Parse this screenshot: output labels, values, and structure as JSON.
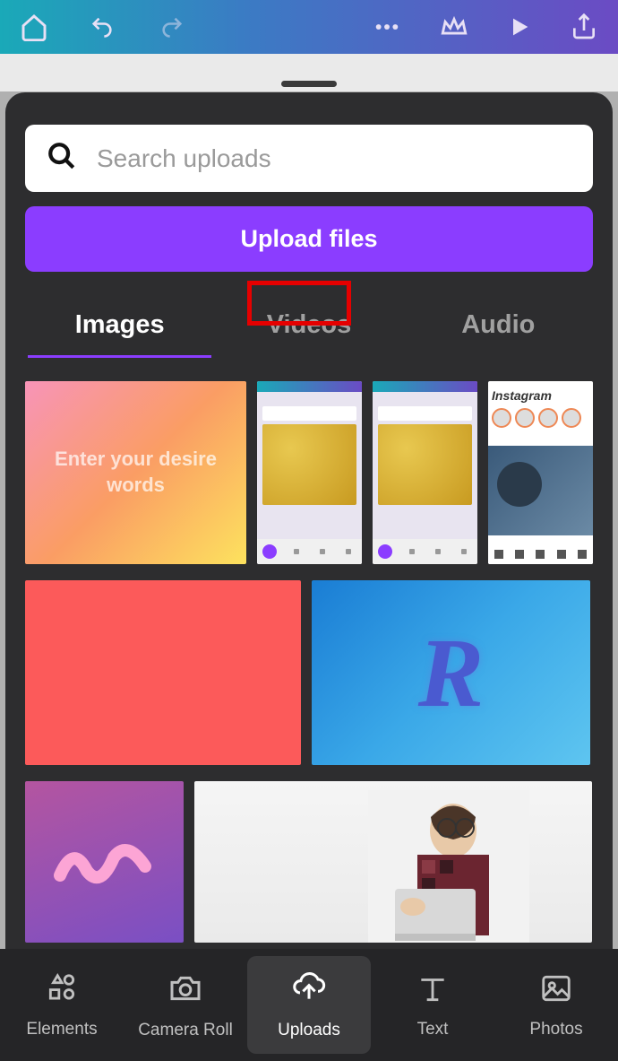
{
  "top_bar": {
    "home_icon": "home",
    "undo_icon": "undo",
    "redo_icon": "redo",
    "more_icon": "more",
    "crown_icon": "crown",
    "play_icon": "play",
    "share_icon": "share"
  },
  "search": {
    "placeholder": "Search uploads"
  },
  "upload_button_label": "Upload files",
  "tabs": {
    "images": "Images",
    "videos": "Videos",
    "audio": "Audio",
    "active": "Images",
    "highlighted": "Videos"
  },
  "thumbnails": {
    "thumb1_text": "Enter your desire words",
    "thumb4_brand": "Instagram",
    "thumb6_letter": "R"
  },
  "bottom_nav": {
    "items": [
      {
        "label": "Elements",
        "icon": "shapes"
      },
      {
        "label": "Camera Roll",
        "icon": "camera"
      },
      {
        "label": "Uploads",
        "icon": "cloud-upload"
      },
      {
        "label": "Text",
        "icon": "text"
      },
      {
        "label": "Photos",
        "icon": "photo"
      }
    ],
    "active": "Uploads"
  }
}
